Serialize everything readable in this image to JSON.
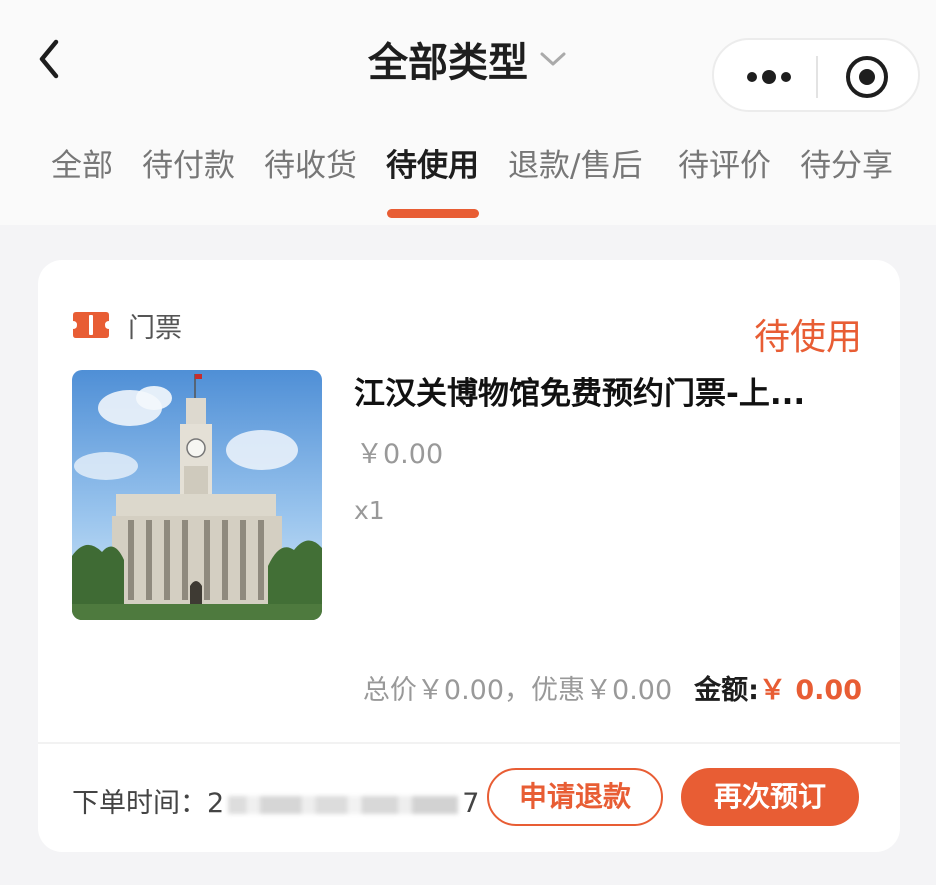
{
  "header": {
    "title": "全部类型"
  },
  "tabs": [
    {
      "label": "全部"
    },
    {
      "label": "待付款"
    },
    {
      "label": "待收货"
    },
    {
      "label": "待使用"
    },
    {
      "label": "退款/售后"
    },
    {
      "label": "待评价"
    },
    {
      "label": "待分享"
    }
  ],
  "active_tab": "待使用",
  "order": {
    "category": "门票",
    "status": "待使用",
    "product_name": "江汉关博物馆免费预约门票-上...",
    "unit_price": "￥0.00",
    "quantity": "x1",
    "summary_text": "总价￥0.00，优惠￥0.00",
    "amount_label": "金额:",
    "amount_value": "￥ 0.00",
    "order_time_label": "下单时间：",
    "order_time_prefix": "2",
    "order_time_suffix": "7",
    "refund_button": "申请退款",
    "rebook_button": "再次预订"
  },
  "colors": {
    "accent": "#e85d34",
    "background": "#f4f4f6"
  },
  "icons": [
    "back-icon",
    "chevron-down-icon",
    "more-dots-icon",
    "target-icon",
    "ticket-icon"
  ]
}
